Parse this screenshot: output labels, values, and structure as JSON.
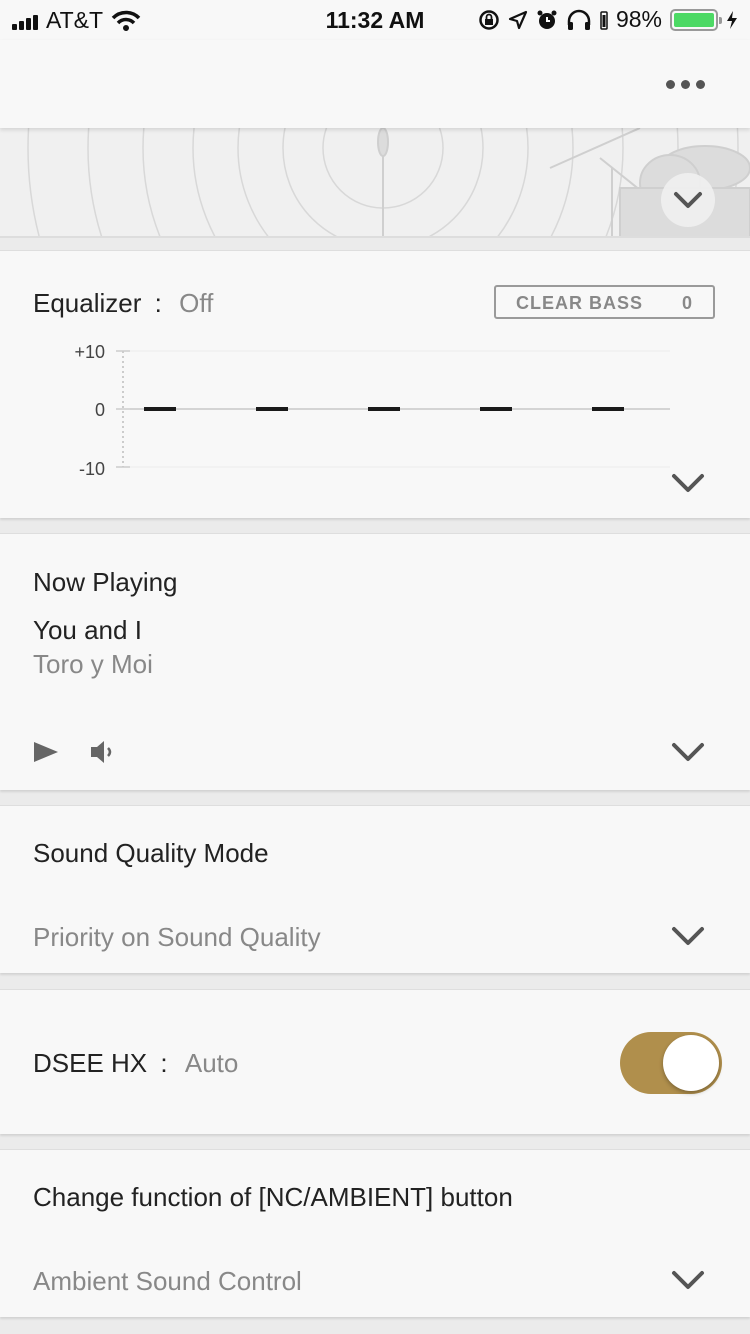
{
  "status_bar": {
    "carrier": "AT&T",
    "time": "11:32 AM",
    "battery": "98%",
    "battery_level": 0.98,
    "icons": [
      "signal-icon",
      "wifi-icon",
      "orientation-lock-icon",
      "location-icon",
      "alarm-icon",
      "headphones-icon",
      "battery-icon",
      "charging-icon"
    ]
  },
  "nav": {
    "more_icon": "more-icon"
  },
  "equalizer": {
    "title": "Equalizer",
    "separator": ":",
    "value": "Off",
    "clear_bass_label": "CLEAR BASS",
    "clear_bass_value": "0",
    "y_ticks": [
      "+10",
      "0",
      "-10"
    ],
    "bands": [
      0,
      0,
      0,
      0,
      0
    ]
  },
  "now_playing": {
    "title": "Now Playing",
    "track": "You and I",
    "artist": "Toro y Moi"
  },
  "sound_quality": {
    "title": "Sound Quality Mode",
    "value": "Priority on Sound Quality"
  },
  "dsee": {
    "title": "DSEE HX",
    "separator": ":",
    "value": "Auto",
    "toggle_on": true,
    "accent": "#b08f4c"
  },
  "nc_button": {
    "title": "Change function of [NC/AMBIENT] button",
    "value": "Ambient Sound Control"
  }
}
